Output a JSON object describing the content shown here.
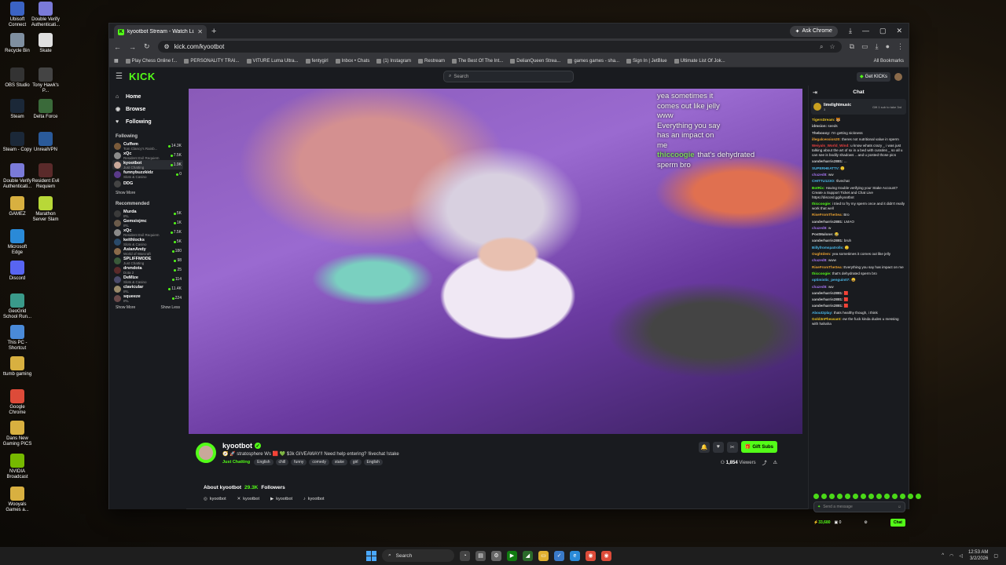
{
  "desktop": {
    "icons": [
      {
        "label": "Ubisoft Connect",
        "icon": "ubisoft-icon",
        "color": "#3b63c4"
      },
      {
        "label": "Double Verify Authenticati...",
        "icon": "doubleverify-icon",
        "color": "#7a7ad8"
      },
      {
        "label": "Recycle Bin",
        "icon": "recycle-bin-icon",
        "color": "#7f8fa0"
      },
      {
        "label": "Skate",
        "icon": "skate-icon",
        "color": "#e0e0e0"
      },
      {
        "label": "OBS Studio",
        "icon": "obs-icon",
        "color": "#333"
      },
      {
        "label": "Tony Hawk's P...",
        "icon": "tonyhawk-icon",
        "color": "#444"
      },
      {
        "label": "Steam",
        "icon": "steam-icon",
        "color": "#1b2838"
      },
      {
        "label": "Delta Force",
        "icon": "deltaforce-icon",
        "color": "#3a6a3a"
      },
      {
        "label": "Steam - Copy",
        "icon": "steam-icon",
        "color": "#1b2838"
      },
      {
        "label": "UnrealVPN",
        "icon": "vpn-icon",
        "color": "#2a5a9a"
      },
      {
        "label": "Double Verify Authenticati...",
        "icon": "doubleverify-icon",
        "color": "#7a7ad8"
      },
      {
        "label": "Resident Evil Requiem",
        "icon": "re-icon",
        "color": "#5a2a2a"
      },
      {
        "label": "GAMEZ",
        "icon": "folder-icon",
        "color": "#d8b040"
      },
      {
        "label": "Marathon Server Slam",
        "icon": "marathon-icon",
        "color": "#b8d838"
      },
      {
        "label": "Microsoft Edge",
        "icon": "edge-icon",
        "color": "#2a8ad8"
      },
      {
        "label": "Discord",
        "icon": "discord-icon",
        "color": "#5865f2"
      },
      {
        "label": "GeoGrid School Run...",
        "icon": "geogrid-icon",
        "color": "#3a9a8a"
      },
      {
        "label": "This PC - Shortcut",
        "icon": "pc-icon",
        "color": "#4a8ad8"
      },
      {
        "label": "ttumb gaming",
        "icon": "folder-icon",
        "color": "#d8b040"
      },
      {
        "label": "Google Chrome",
        "icon": "chrome-icon",
        "color": "#dd4b39"
      },
      {
        "label": "Dans New Gaming PICS",
        "icon": "folder-icon",
        "color": "#d8b040"
      },
      {
        "label": "NVIDIA Broadcast",
        "icon": "nvidia-icon",
        "color": "#76b900"
      },
      {
        "label": "Wooyals Games a...",
        "icon": "folder-icon",
        "color": "#d8b040"
      }
    ]
  },
  "browser": {
    "tab_title": "kyootbot Stream - Watch Li...",
    "url": "kick.com/kyootbot",
    "ask_chrome": "Ask Chrome",
    "bookmarks": [
      "Play Chess Online f...",
      "PERSONALITY TRAI...",
      "VITURE Luma Ultra...",
      "fentygirl",
      "Inbox • Chats",
      "(1) Instagram",
      "Restream",
      "The Best Of The Int...",
      "DelianQueen Strea...",
      "games games - sha...",
      "Sign In | JetBlue",
      "Ultimate List Of Jok..."
    ],
    "all_bookmarks": "All Bookmarks"
  },
  "kick": {
    "logo": "KICK",
    "search_placeholder": "Search",
    "get_kicks": "Get KICKs",
    "nav": [
      {
        "label": "Home",
        "icon": "home-icon",
        "glyph": "⌂"
      },
      {
        "label": "Browse",
        "icon": "browse-icon",
        "glyph": "◉"
      },
      {
        "label": "Following",
        "icon": "heart-icon",
        "glyph": "♥"
      }
    ],
    "following_title": "Following",
    "following": [
      {
        "name": "Cuffem",
        "cat": "Tom Clancy's Rainb...",
        "viewers": "14.3K",
        "color": "#7a5a3a"
      },
      {
        "name": "xQc",
        "cat": "Resident Evil Requiem",
        "viewers": "7.5K",
        "color": "#8a8a8a"
      },
      {
        "name": "kyootbot",
        "cat": "Just Chatting",
        "viewers": "1.9K",
        "color": "#c9a89a",
        "active": true
      },
      {
        "name": "funnybuzzkidz",
        "cat": "Slots & Casino",
        "viewers": "0",
        "color": "#5a3a8a"
      },
      {
        "name": "DDG",
        "cat": "",
        "viewers": "",
        "color": "#444"
      }
    ],
    "show_more": "Show More",
    "recommended_title": "Recommended",
    "recommended": [
      {
        "name": "Murda",
        "cat": "IRL",
        "viewers": "5K",
        "color": "#3a3a3a"
      },
      {
        "name": "Gemsiojmc",
        "cat": "IRL",
        "viewers": "1K",
        "color": "#6a5a4a"
      },
      {
        "name": "xQc",
        "cat": "Resident Evil Requiem",
        "viewers": "7.5K",
        "color": "#8a8a8a"
      },
      {
        "name": "keithlocks",
        "cat": "Slots & Casino",
        "viewers": "5K",
        "color": "#2a4a6a"
      },
      {
        "name": "AsianAndy",
        "cat": "World of Warcraft",
        "viewers": "180",
        "color": "#8a6a4a"
      },
      {
        "name": "SPLIFFMODE",
        "cat": "Just Chatting",
        "viewers": "98",
        "color": "#3a5a3a"
      },
      {
        "name": "drvndota",
        "cat": "Dota 2",
        "viewers": "25",
        "color": "#5a2a2a"
      },
      {
        "name": "DeMize",
        "cat": "Slots & Casino",
        "viewers": "114",
        "color": "#4a4a6a"
      },
      {
        "name": "clavicular",
        "cat": "IRL",
        "viewers": "11.4K",
        "color": "#9a8a6a"
      },
      {
        "name": "squeeze",
        "cat": "IRL",
        "viewers": "224",
        "color": "#6a4a4a"
      }
    ],
    "show_more_2": "Show More",
    "show_less": "Show Less"
  },
  "overlay_chat": [
    {
      "user": "",
      "text": "yea sometimes it"
    },
    {
      "user": "",
      "text": "comes out like jelly"
    },
    {
      "user": "",
      "text": "www"
    },
    {
      "user": "",
      "text": "Everything you say"
    },
    {
      "user": "",
      "text": "has an impact on"
    },
    {
      "user": "",
      "text": "me"
    },
    {
      "user": "thiccoogie",
      "text": "that's dehydrated"
    },
    {
      "user": "",
      "text": "sperm bro"
    }
  ],
  "stream": {
    "channel": "kyootbot",
    "title": "🧭 🚀 stratosphere Ws 🟥 💚 $3k GIVEAWAY!! Need help entering? !livechat !stake",
    "category": "Just Chatting",
    "tags": [
      "English",
      "chill",
      "funny",
      "comedy",
      "stake",
      "girl",
      "English"
    ],
    "gift_subs": "Gift Subs",
    "viewers": "1,854",
    "viewers_label": "Viewers"
  },
  "about": {
    "title": "About kyootbot",
    "followers": "29.3K",
    "followers_label": "Followers",
    "socials": [
      {
        "icon": "instagram-icon",
        "glyph": "◎",
        "label": "kyootbot"
      },
      {
        "icon": "x-icon",
        "glyph": "✕",
        "label": "kyootbot"
      },
      {
        "icon": "youtube-icon",
        "glyph": "▶",
        "label": "kyootbot"
      },
      {
        "icon": "tiktok-icon",
        "glyph": "♪",
        "label": "kyootbot"
      }
    ]
  },
  "chat": {
    "title": "Chat",
    "pinned_user": "limelightmusic",
    "pinned_text": "Gift 1 sub to take 3rd",
    "pinned_count": "3",
    "messages": [
      {
        "user": "TigersDream:",
        "text": "🐯",
        "color": "#e8c020"
      },
      {
        "user": "idmsion:",
        "text": "seeds",
        "color": "#d0d0d0"
      },
      {
        "user": "Theboooy:",
        "text": "I'm getting sickness",
        "color": "#d0d0d0"
      },
      {
        "user": "illegalcession20:",
        "text": "theres not nutritional value in sperm",
        "color": "#e8a030"
      },
      {
        "user": "Weiyals_World_Wind:",
        "text": "u know whats crazy _ i was just talking about the art of sx in a bed with curatins _ so all u can see is bodily shadows .. and u posted those pics",
        "color": "#e84040"
      },
      {
        "user": "xanderharris2881:",
        "text": "...",
        "color": "#d0d0d0"
      },
      {
        "user": "SUPERHEATTV:",
        "text": "🙂",
        "color": "#4ab8e8"
      },
      {
        "user": "chazed8:",
        "text": "ww",
        "color": "#a070e8"
      },
      {
        "user": "CHITTU123O:",
        "text": "!livechat",
        "color": "#4ab8e8"
      },
      {
        "user": "BotRix:",
        "text": "Having trouble verifying your Stake Account? Create a Support Ticket and Chat Live https://discord.gg/kyootbot",
        "color": "#53fc18"
      },
      {
        "user": "thiccoogie:",
        "text": "i tried to fry my sperm once and it didn't really work that well",
        "color": "#53fc18"
      },
      {
        "user": "RiseFromTheSea:",
        "text": "Bro",
        "color": "#e8a030"
      },
      {
        "user": "xanderharris2881:",
        "text": "LMAO",
        "color": "#d0d0d0"
      },
      {
        "user": "chazed8:",
        "text": "w",
        "color": "#a070e8"
      },
      {
        "user": "PostMalone:",
        "text": "😂",
        "color": "#d0d0d0"
      },
      {
        "user": "xanderharris2881:",
        "text": "bruh",
        "color": "#d0d0d0"
      },
      {
        "user": "Billyfromspatrolls:",
        "text": "🙂",
        "color": "#4ab8e8"
      },
      {
        "user": "Oughtdem:",
        "text": "yea sometimes it comes out like jelly",
        "color": "#e8a030"
      },
      {
        "user": "chazed8:",
        "text": "www",
        "color": "#a070e8"
      },
      {
        "user": "RiseFromTheSea:",
        "text": "Everything you say has impact on me",
        "color": "#e8a030"
      },
      {
        "user": "thiccoogie:",
        "text": "that's dehydrated sperm bro",
        "color": "#53fc18"
      },
      {
        "user": "optimistic_penguin07:",
        "text": "😀",
        "color": "#4ab8e8"
      },
      {
        "user": "chazed8:",
        "text": "ww",
        "color": "#a070e8"
      },
      {
        "user": "xanderharris2881:",
        "text": "🟥",
        "color": "#d0d0d0"
      },
      {
        "user": "xanderharris2881:",
        "text": "🟥",
        "color": "#d0d0d0"
      },
      {
        "user": "xanderharris2881:",
        "text": "🟥",
        "color": "#d0d0d0"
      },
      {
        "user": "About2play:",
        "text": "thats healthy though, i think",
        "color": "#4ab8e8"
      },
      {
        "user": "Gold3nPheasant:",
        "text": "ew the fuck kinda dudes u messing with hahaha",
        "color": "#e8c020"
      }
    ],
    "input_placeholder": "Send a message",
    "kicks_count": "33,680",
    "points": "0",
    "chat_button": "Chat"
  },
  "taskbar": {
    "search": "Search",
    "time": "12:53 AM",
    "date": "3/2/2026"
  }
}
